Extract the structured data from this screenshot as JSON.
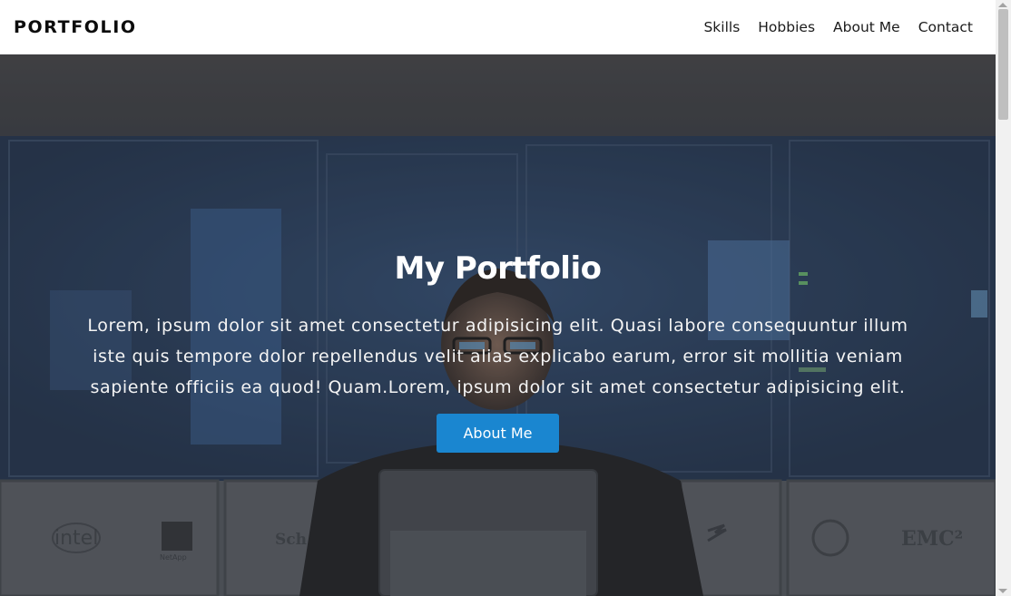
{
  "navbar": {
    "brand": "PORTFOLIO",
    "links": [
      "Skills",
      "Hobbies",
      "About Me",
      "Contact"
    ]
  },
  "hero": {
    "title": "My Portfolio",
    "text": "Lorem, ipsum dolor sit amet consectetur adipisicing elit. Quasi labore consequuntur illum iste quis tempore dolor repellendus velit alias explicabo earum, error sit mollitia veniam sapiente officiis ea quod! Quam.Lorem, ipsum dolor sit amet consectetur adipisicing elit.",
    "button_label": "About Me",
    "background_logos": [
      "intel",
      "NetApp",
      "Sch",
      "EMC²"
    ]
  },
  "colors": {
    "accent": "#1a86d0",
    "navbar_bg": "#ffffff",
    "hero_dark": "#2c3036"
  }
}
